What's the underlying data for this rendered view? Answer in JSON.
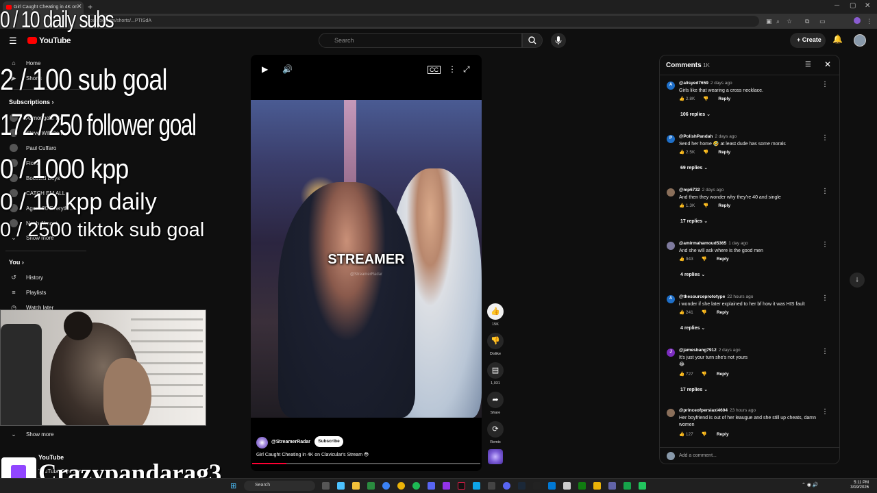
{
  "browser": {
    "tab_title": "Girl Caught Cheating in 4K on",
    "url_text": "youtube.com/shorts/...PTISdA"
  },
  "youtube": {
    "logo_text": "YouTube",
    "search_placeholder": "Search",
    "create_label": "Create"
  },
  "sidebar": {
    "home": "Home",
    "shorts": "Shorts",
    "subscriptions": "Subscriptions",
    "subs": [
      "Asmongold TV",
      "Steve Will Do It",
      "Paul Cuffaro",
      "Fiona",
      "Boosted Boys",
      "CATCH EM ALL",
      "Agent 00 Everyth...",
      "Noah Almost"
    ],
    "show_more_subs": "Show more",
    "you": "You",
    "history": "History",
    "playlists": "Playlists",
    "watch_later": "Watch later",
    "show_more": "Show more",
    "youtube_section": "YouTube",
    "premium": "YouTube Premium"
  },
  "overlay": {
    "daily_subs": "0 / 10 daily subs",
    "sub_goal": "2  / 100 sub goal",
    "follower_goal": "172 / 250 follower goal",
    "kpp": "0 / 1000 kpp",
    "kpp_daily": "0 / 10 kpp daily",
    "tiktok_goal": "0 / 2500 tiktok sub goal",
    "streamer_name": "Crazypandarag3"
  },
  "video": {
    "caption": "STREAMER",
    "watermark": "@StreamerRadar",
    "channel": "@StreamerRadar",
    "subscribe_label": "Subscribe",
    "title": "Girl Caught Cheating in 4K on Clavicular's Stream 😳",
    "progress": 0.15
  },
  "actions": {
    "likes": "15K",
    "dislike": "Dislike",
    "comments": "1,031",
    "share": "Share",
    "remix": "Remix"
  },
  "comments": {
    "title": "Comments",
    "count": "1K",
    "add_placeholder": "Add a comment...",
    "reply_label": "Reply",
    "items": [
      {
        "handle": "@alisyed7659",
        "time": "2 days ago",
        "text": "Girls like that wearing a cross necklace.",
        "likes": "2.8K",
        "replies": "106 replies",
        "initial": "A",
        "color": "#1e6fc9"
      },
      {
        "handle": "@PolishPandah",
        "time": "2 days ago",
        "text": "Send her home 🤣 at least dude has some morals",
        "likes": "2.5K",
        "replies": "69 replies",
        "initial": "P",
        "color": "#1e6fc9"
      },
      {
        "handle": "@mp6732",
        "time": "2 days ago",
        "text": "And then they wonder why they're 40 and single",
        "likes": "1.3K",
        "replies": "17 replies",
        "initial": "",
        "color": "#8a6f5a"
      },
      {
        "handle": "@amirmahamoud5365",
        "time": "1 day ago",
        "text": "And she will ask where is the good men",
        "likes": "943",
        "replies": "4 replies",
        "initial": "",
        "color": "#7e7a9e"
      },
      {
        "handle": "@thesourceprototype",
        "time": "22 hours ago",
        "text": "i wonder if she later explained to her bf how it was HIS fault",
        "likes": "241",
        "replies": "4 replies",
        "initial": "A",
        "color": "#1e6fc9"
      },
      {
        "handle": "@jamesbang7912",
        "time": "2 days ago",
        "text": "It's just your turn she's not yours",
        "text2": "😂",
        "likes": "727",
        "replies": "17 replies",
        "initial": "J",
        "color": "#7b2cbf"
      },
      {
        "handle": "@princeofpersiaxi4604",
        "time": "23 hours ago",
        "text": "Her boyfriend is out of her leaugue and she still up cheats, damn women",
        "likes": "127",
        "replies": "",
        "initial": "",
        "color": "#8a6f5a"
      }
    ]
  },
  "taskbar": {
    "search_label": "Search",
    "time": "5:11 PM",
    "date": "3/19/2026"
  }
}
